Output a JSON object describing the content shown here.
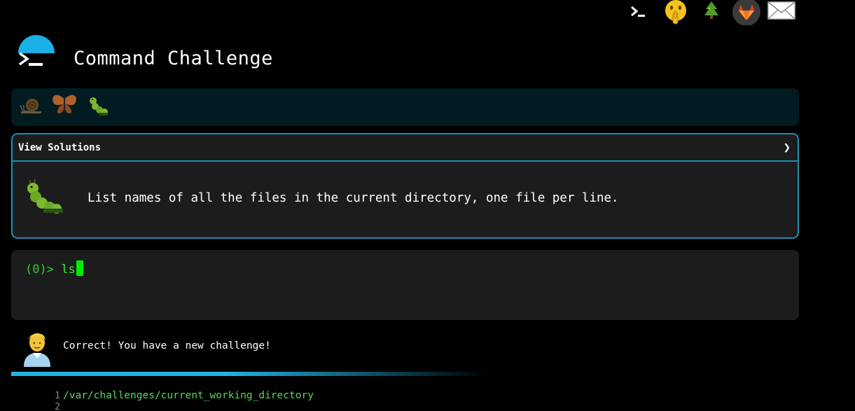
{
  "header": {
    "title": "Command Challenge",
    "top_icons": [
      "terminal-icon",
      "shush-face-icon",
      "tree-icon",
      "gitlab-icon",
      "envelope-icon"
    ]
  },
  "levels": [
    "snail-icon",
    "butterfly-icon",
    "caterpillar-icon"
  ],
  "challenge": {
    "toggle_label": "View Solutions",
    "toggle_glyph": "❯",
    "description": "List names of all the files in the current directory, one file per line."
  },
  "terminal": {
    "prompt": "(0)>",
    "input": "ls"
  },
  "feedback": {
    "message": "Correct! You have a new challenge!",
    "progress_fraction": 0.45
  },
  "output": {
    "lines": [
      {
        "num": "1",
        "text": "/var/challenges/current_working_directory"
      },
      {
        "num": "2",
        "text": ""
      }
    ]
  },
  "colors": {
    "accent": "#1ab0e6",
    "prompt_green": "#33cc33",
    "level_bar": "#011b21",
    "card_bg": "#1c1c1c"
  }
}
